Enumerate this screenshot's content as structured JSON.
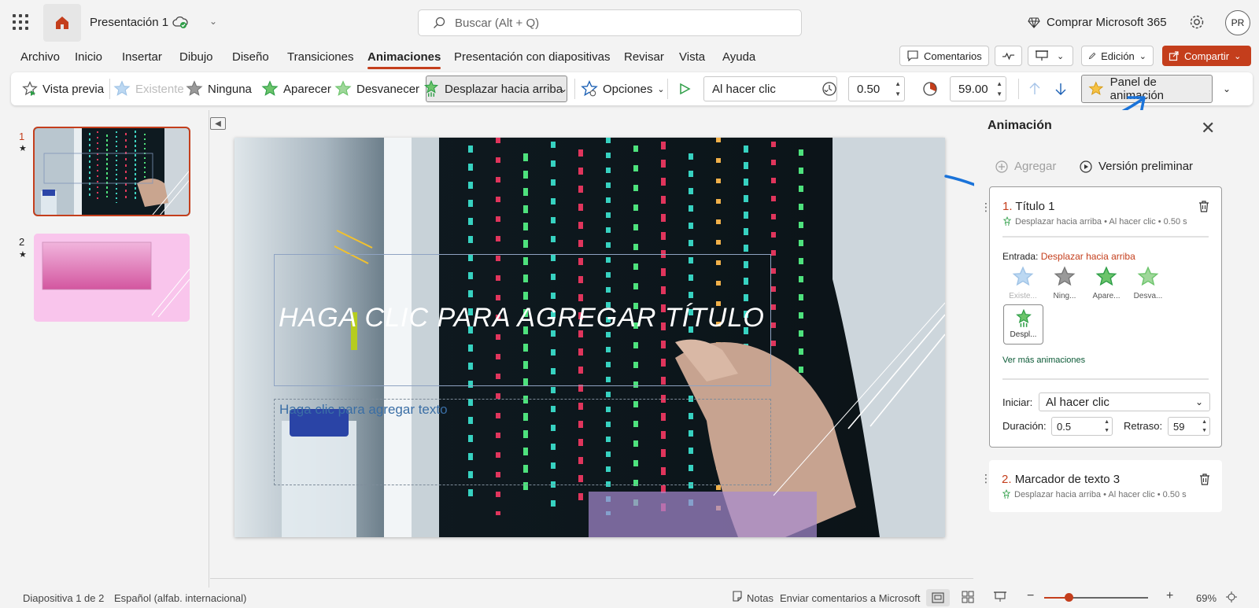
{
  "titlebar": {
    "doc_title": "Presentación 1",
    "search_placeholder": "Buscar (Alt + Q)",
    "buy_label": "Comprar Microsoft 365",
    "avatar_initials": "PR"
  },
  "menu": {
    "tabs": [
      "Archivo",
      "Inicio",
      "Insertar",
      "Dibujo",
      "Diseño",
      "Transiciones",
      "Animaciones",
      "Presentación con diapositivas",
      "Revisar",
      "Vista",
      "Ayuda"
    ],
    "comments_label": "Comentarios",
    "edit_label": "Edición",
    "share_label": "Compartir"
  },
  "ribbon": {
    "preview_label": "Vista previa",
    "existing_label": "Existente",
    "none_label": "Ninguna",
    "appear_label": "Aparecer",
    "fade_label": "Desvanecer",
    "flyup_label": "Desplazar hacia arriba",
    "options_label": "Opciones",
    "start_value": "Al hacer clic",
    "duration_value": "0.50",
    "delay_value": "59.00",
    "panel_label": "Panel de animación"
  },
  "thumbnails": [
    {
      "number": "1"
    },
    {
      "number": "2"
    }
  ],
  "slide": {
    "title_placeholder": "HAGA CLIC PARA AGREGAR TÍTULO",
    "body_placeholder": "Haga clic para agregar texto"
  },
  "animation_pane": {
    "title": "Animación",
    "add_label": "Agregar",
    "preview_label": "Versión preliminar",
    "items": [
      {
        "num": "1.",
        "name": "Título 1",
        "detail": "Desplazar hacia arriba • Al hacer clic • 0.50 s"
      },
      {
        "num": "2.",
        "name": "Marcador de texto 3",
        "detail": "Desplazar hacia arriba • Al hacer clic • 0.50 s"
      }
    ],
    "entrada_label": "Entrada:",
    "entrada_value": "Desplazar hacia arriba",
    "effects": [
      "Existe...",
      "Ning...",
      "Apare...",
      "Desva...",
      "Despl..."
    ],
    "more_label": "Ver más animaciones",
    "start_label": "Iniciar:",
    "start_value": "Al hacer clic",
    "duration_label": "Duración:",
    "duration_value": "0.5",
    "delay_label": "Retraso:",
    "delay_value": "59"
  },
  "statusbar": {
    "slide_info": "Diapositiva 1 de 2",
    "language": "Español (alfab. internacional)",
    "notes_label": "Notas",
    "feedback_label": "Enviar comentarios a Microsoft",
    "zoom": "69%"
  },
  "colors": {
    "accent": "#c43e1c",
    "arrow_annotation": "#1a73d9",
    "green_star": "#3bb54a"
  }
}
